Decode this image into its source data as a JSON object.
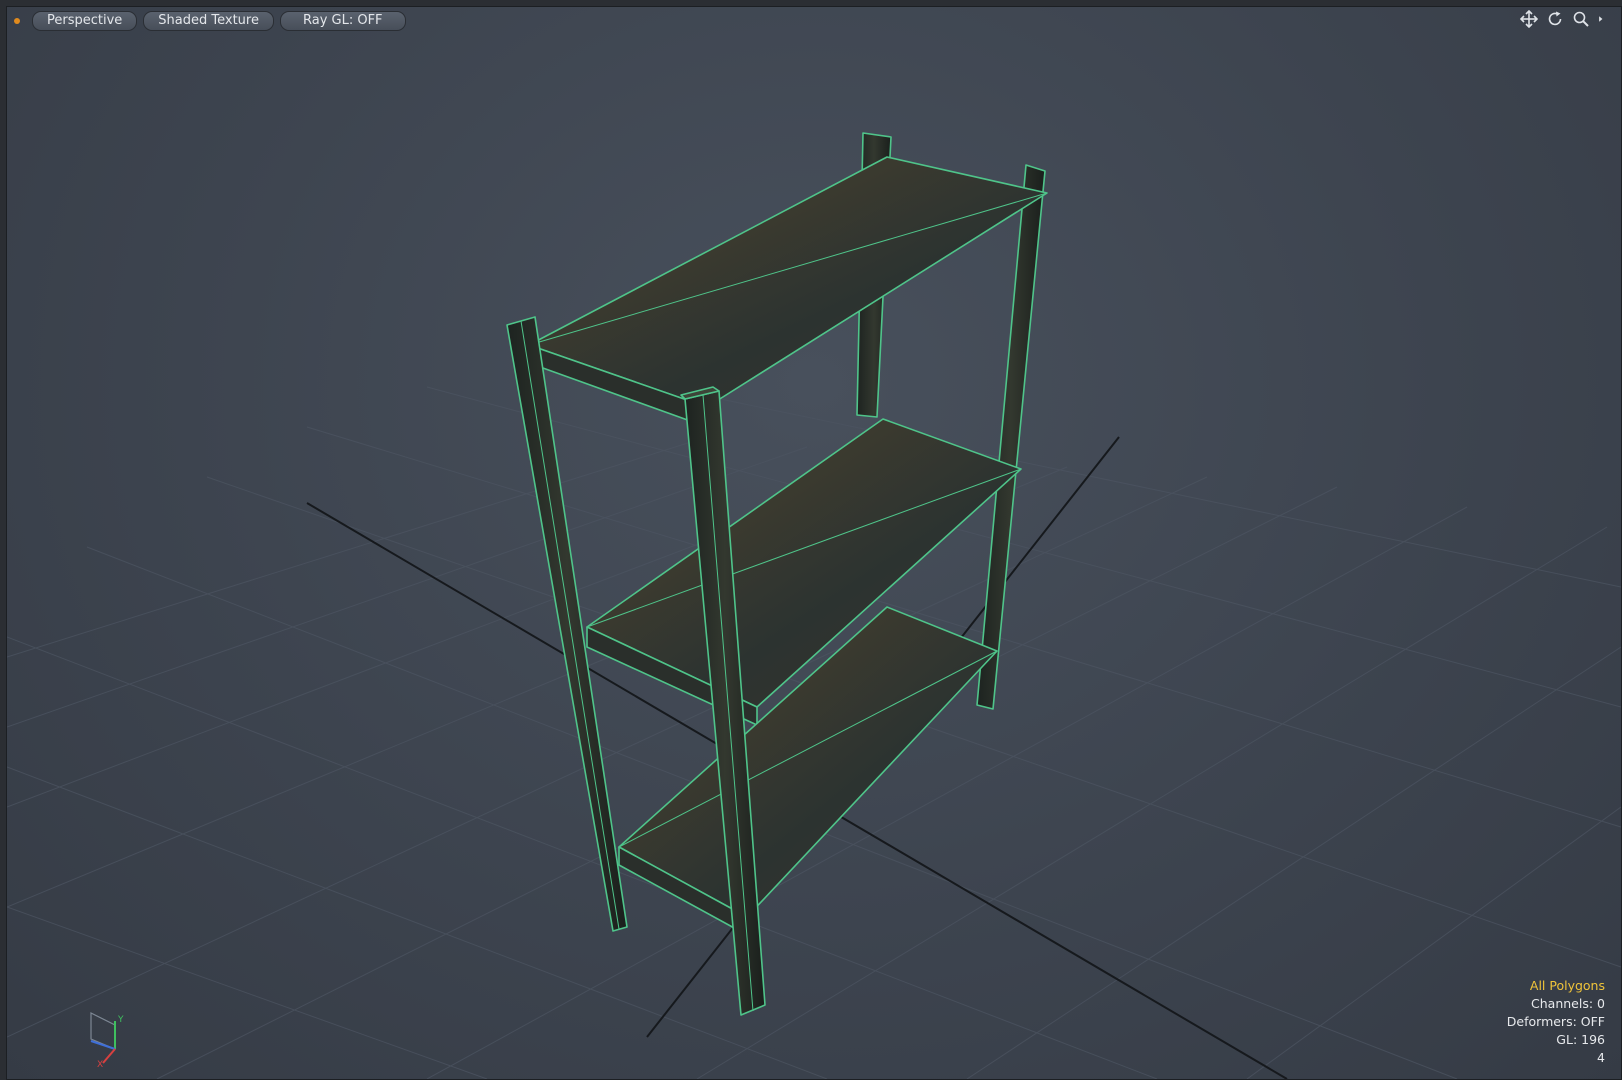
{
  "toolbar": {
    "view_mode": "Perspective",
    "shading_mode": "Shaded Texture",
    "ray_gl": "Ray GL: OFF"
  },
  "nav_icons": [
    "move-view-icon",
    "rotate-view-icon",
    "zoom-view-icon",
    "more-arrow-icon"
  ],
  "stats": {
    "selection_mode": "All Polygons",
    "channels": "Channels: 0",
    "deformers": "Deformers: OFF",
    "gl": "GL: 196",
    "extra": "4"
  },
  "axis": {
    "y": "Y",
    "x": "X"
  },
  "colors": {
    "wireframe": "#4fc48a",
    "selection_text": "#f0c43a",
    "status_dot": "#e08a1e"
  }
}
